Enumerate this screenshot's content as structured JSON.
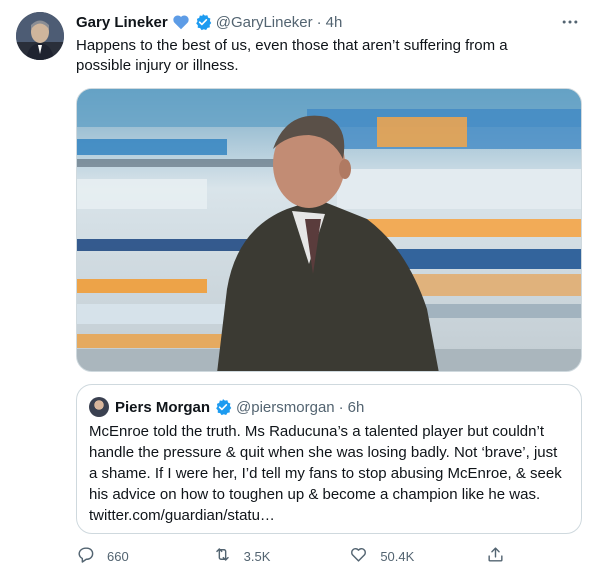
{
  "tweet": {
    "author_name": "Gary Lineker",
    "author_handle": "@GaryLineker",
    "separator": "·",
    "time": "4h",
    "text": "Happens to the best of us, even those that aren’t suffering from a possible injury or illness.",
    "heart_badge_color": "#5d9ce6",
    "verified_color": "#1d9bf0",
    "icons": {
      "more": "more-icon",
      "heart_badge": "blue-heart-icon",
      "verified": "verified-badge-icon"
    }
  },
  "quote": {
    "author_name": "Piers Morgan",
    "author_handle": "@piersmorgan",
    "separator": "·",
    "time": "6h",
    "text": "McEnroe told the truth. Ms Raducuna’s a talented player but couldn’t handle the pressure & quit when she was losing badly. Not ‘brave’, just a shame. If I were her, I’d tell my fans to stop abusing  McEnroe, & seek his advice on how to toughen up & become a champion like he was. twitter.com/guardian/statu…"
  },
  "actions": {
    "reply_count": "660",
    "retweet_count": "3.5K",
    "like_count": "50.4K",
    "icons": [
      "reply-icon",
      "retweet-icon",
      "like-icon",
      "share-icon"
    ]
  }
}
